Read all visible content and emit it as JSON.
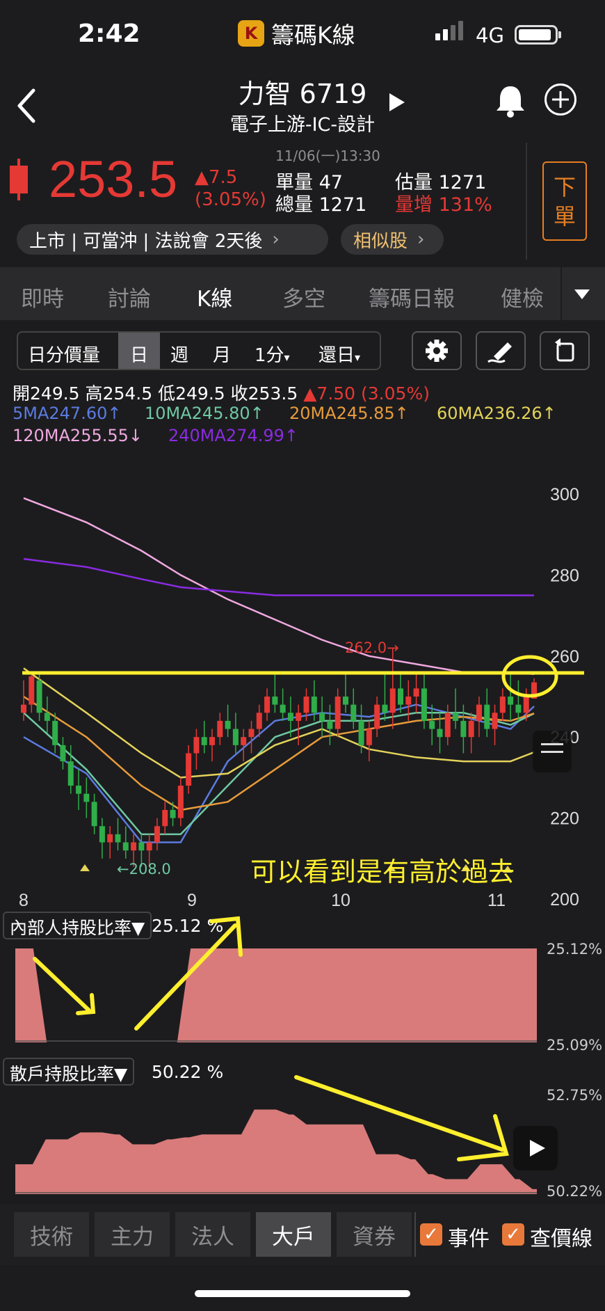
{
  "status_bar": {
    "time": "2:42",
    "app_name": "籌碼K線",
    "network": "4G"
  },
  "header": {
    "stock_name": "力智 6719",
    "industry": "電子上游-IC-設計"
  },
  "quote": {
    "price": "253.5",
    "change": "▲7.5",
    "change_pct": "(3.05%)",
    "datetime": "11/06(一)13:30",
    "single_vol_label": "單量",
    "single_vol": "47",
    "est_vol_label": "估量",
    "est_vol": "1271",
    "total_vol_label": "總量",
    "total_vol": "1271",
    "vol_inc_label": "量增",
    "vol_inc": "131%",
    "order_button": "下單",
    "tags": "上市 | 可當沖 | 法說會 2天後",
    "similar": "相似股",
    "colors": {
      "up": "#e53935",
      "accent": "#e67e22"
    }
  },
  "tabs": [
    "即時",
    "討論",
    "K線",
    "多空",
    "籌碼日報",
    "健檢"
  ],
  "active_tab": "K線",
  "toolbar": {
    "items": [
      "日分價量",
      "日",
      "週",
      "月",
      "1分",
      "還日"
    ],
    "active": "日",
    "icons": [
      "gear-icon",
      "pen-icon",
      "rotate-icon"
    ]
  },
  "ohlc": {
    "open_label": "開",
    "open": "249.5",
    "high_label": "高",
    "high": "254.5",
    "low_label": "低",
    "low": "249.5",
    "close_label": "收",
    "close": "253.5",
    "change": "▲7.50 (3.05%)"
  },
  "ma": {
    "ma5": "5MA247.60↑",
    "ma10": "10MA245.80↑",
    "ma20": "20MA245.85↑",
    "ma60": "60MA236.26↑",
    "ma120": "120MA255.55↓",
    "ma240": "240MA274.99↑"
  },
  "chart_data": {
    "type": "line",
    "y_ticks": [
      "300",
      "280",
      "260",
      "240",
      "220",
      "200"
    ],
    "x_ticks": [
      "8",
      "9",
      "10",
      "11"
    ],
    "ylim": [
      200,
      300
    ],
    "series": [
      {
        "name": "5MA",
        "color": "#5b7be0",
        "x": [
          8.0,
          8.4,
          8.75,
          9.0,
          9.3,
          9.6,
          9.9,
          10.2,
          10.5,
          10.8,
          11.1,
          11.25
        ],
        "values": [
          240,
          231,
          214,
          214,
          234,
          244,
          246,
          245,
          248,
          245,
          242,
          247.6
        ]
      },
      {
        "name": "10MA",
        "color": "#6fc9a3",
        "x": [
          8.0,
          8.4,
          8.75,
          9.0,
          9.3,
          9.6,
          9.9,
          10.2,
          10.5,
          10.8,
          11.1,
          11.25
        ],
        "values": [
          246,
          232,
          216,
          216,
          228,
          240,
          244,
          244,
          246,
          246,
          243,
          245.8
        ]
      },
      {
        "name": "20MA",
        "color": "#e89b3b",
        "x": [
          8.0,
          8.4,
          8.75,
          9.0,
          9.3,
          9.6,
          9.9,
          10.2,
          10.5,
          10.8,
          11.1,
          11.25
        ],
        "values": [
          250,
          240,
          228,
          222,
          224,
          232,
          240,
          242,
          244,
          245,
          244,
          245.85
        ]
      },
      {
        "name": "60MA",
        "color": "#e4d35a",
        "x": [
          8.0,
          8.4,
          8.75,
          9.0,
          9.3,
          9.6,
          9.9,
          10.2,
          10.5,
          10.8,
          11.1,
          11.25
        ],
        "values": [
          257,
          246,
          236,
          230,
          231,
          238,
          242,
          237,
          235,
          234,
          234,
          236.26
        ]
      },
      {
        "name": "120MA",
        "color": "#f0a8e0",
        "x": [
          8.0,
          8.4,
          8.75,
          9.0,
          9.3,
          9.6,
          9.9,
          10.2,
          10.5,
          10.8,
          11.1,
          11.25
        ],
        "values": [
          299,
          293,
          286,
          280,
          274,
          269,
          264,
          260,
          258,
          256,
          256,
          255.55
        ]
      },
      {
        "name": "240MA",
        "color": "#8a2be2",
        "x": [
          8.0,
          8.4,
          8.75,
          9.0,
          9.3,
          9.6,
          9.9,
          10.2,
          10.5,
          10.8,
          11.1,
          11.25
        ],
        "values": [
          284,
          282,
          279,
          277,
          276,
          275,
          275,
          275,
          275,
          275,
          275,
          274.99
        ]
      }
    ],
    "candles": [
      [
        8.0,
        246,
        254,
        244,
        248
      ],
      [
        8.05,
        248,
        256,
        246,
        255
      ],
      [
        8.1,
        254,
        256,
        244,
        246
      ],
      [
        8.15,
        246,
        250,
        241,
        244
      ],
      [
        8.2,
        244,
        246,
        236,
        238
      ],
      [
        8.25,
        238,
        240,
        232,
        234
      ],
      [
        8.3,
        234,
        238,
        226,
        228
      ],
      [
        8.35,
        228,
        232,
        222,
        226
      ],
      [
        8.4,
        226,
        230,
        220,
        224
      ],
      [
        8.45,
        224,
        226,
        216,
        218
      ],
      [
        8.5,
        218,
        220,
        210,
        214
      ],
      [
        8.55,
        214,
        218,
        210,
        216
      ],
      [
        8.6,
        216,
        220,
        212,
        214
      ],
      [
        8.65,
        214,
        218,
        210,
        212
      ],
      [
        8.7,
        212,
        216,
        208,
        214
      ],
      [
        8.75,
        214,
        216,
        208,
        212
      ],
      [
        8.8,
        212,
        216,
        208,
        214
      ],
      [
        8.85,
        214,
        220,
        212,
        218
      ],
      [
        8.9,
        218,
        224,
        216,
        222
      ],
      [
        8.95,
        222,
        224,
        218,
        220
      ],
      [
        9.0,
        220,
        230,
        218,
        228
      ],
      [
        9.05,
        228,
        238,
        226,
        236
      ],
      [
        9.1,
        236,
        242,
        232,
        240
      ],
      [
        9.15,
        240,
        244,
        236,
        238
      ],
      [
        9.2,
        238,
        242,
        234,
        240
      ],
      [
        9.25,
        240,
        246,
        238,
        244
      ],
      [
        9.3,
        244,
        248,
        240,
        242
      ],
      [
        9.35,
        242,
        246,
        236,
        238
      ],
      [
        9.4,
        238,
        242,
        234,
        240
      ],
      [
        9.45,
        240,
        244,
        236,
        242
      ],
      [
        9.5,
        242,
        248,
        240,
        246
      ],
      [
        9.55,
        246,
        252,
        244,
        250
      ],
      [
        9.6,
        250,
        256,
        246,
        248
      ],
      [
        9.65,
        248,
        252,
        244,
        246
      ],
      [
        9.7,
        246,
        250,
        240,
        244
      ],
      [
        9.75,
        244,
        248,
        238,
        246
      ],
      [
        9.8,
        246,
        252,
        244,
        250
      ],
      [
        9.85,
        250,
        254,
        244,
        246
      ],
      [
        9.9,
        246,
        250,
        240,
        244
      ],
      [
        9.95,
        244,
        248,
        238,
        242
      ],
      [
        10.0,
        242,
        252,
        240,
        250
      ],
      [
        10.05,
        250,
        256,
        246,
        248
      ],
      [
        10.1,
        248,
        252,
        242,
        244
      ],
      [
        10.15,
        244,
        248,
        236,
        238
      ],
      [
        10.2,
        238,
        244,
        234,
        242
      ],
      [
        10.25,
        242,
        250,
        240,
        248
      ],
      [
        10.3,
        248,
        256,
        244,
        246
      ],
      [
        10.35,
        246,
        262,
        242,
        252
      ],
      [
        10.4,
        252,
        256,
        246,
        248
      ],
      [
        10.45,
        248,
        254,
        244,
        250
      ],
      [
        10.5,
        250,
        256,
        246,
        252
      ],
      [
        10.55,
        252,
        256,
        242,
        244
      ],
      [
        10.6,
        244,
        248,
        238,
        242
      ],
      [
        10.65,
        242,
        246,
        236,
        240
      ],
      [
        10.7,
        240,
        248,
        238,
        246
      ],
      [
        10.75,
        246,
        252,
        242,
        244
      ],
      [
        10.8,
        244,
        248,
        236,
        240
      ],
      [
        10.85,
        240,
        246,
        236,
        244
      ],
      [
        10.9,
        244,
        250,
        240,
        248
      ],
      [
        10.95,
        248,
        252,
        240,
        242
      ],
      [
        11.0,
        242,
        248,
        238,
        246
      ],
      [
        11.05,
        246,
        252,
        244,
        250
      ],
      [
        11.1,
        250,
        256,
        244,
        248
      ],
      [
        11.15,
        248,
        254,
        244,
        246
      ],
      [
        11.2,
        246,
        252,
        244,
        250
      ],
      [
        11.25,
        249.5,
        254.5,
        249.5,
        253.5
      ]
    ],
    "annotations": {
      "high": "262.0→",
      "low": "←208.0"
    }
  },
  "annotation_text": "可以看到是有高於過去",
  "insider": {
    "dropdown": "內部人持股比率▼",
    "value": "25.12 %",
    "y_max": "25.12%",
    "y_min": "25.09%",
    "color": "#d97b7b",
    "levels": [
      1,
      1,
      0,
      0,
      0,
      0,
      0,
      0,
      0,
      0,
      1,
      1,
      1,
      1,
      1,
      1,
      1,
      1,
      1,
      1,
      1,
      1,
      1,
      1,
      1,
      1,
      1,
      1,
      1,
      1
    ]
  },
  "retail": {
    "dropdown": "散戶持股比率▼",
    "value": "50.22 %",
    "y_max": "52.75%",
    "y_min": "50.22%",
    "levels": [
      0.3,
      0.3,
      0.55,
      0.55,
      0.62,
      0.62,
      0.6,
      0.5,
      0.5,
      0.55,
      0.57,
      0.6,
      0.6,
      0.6,
      0.85,
      0.85,
      0.8,
      0.7,
      0.7,
      0.7,
      0.7,
      0.4,
      0.4,
      0.35,
      0.2,
      0.15,
      0.15,
      0.3,
      0.3,
      0.15,
      0.05
    ]
  },
  "bottom_tabs": [
    "技術",
    "主力",
    "法人",
    "大戶",
    "資券"
  ],
  "active_bottom_tab": "大戶",
  "checks": [
    "事件",
    "查價線"
  ]
}
